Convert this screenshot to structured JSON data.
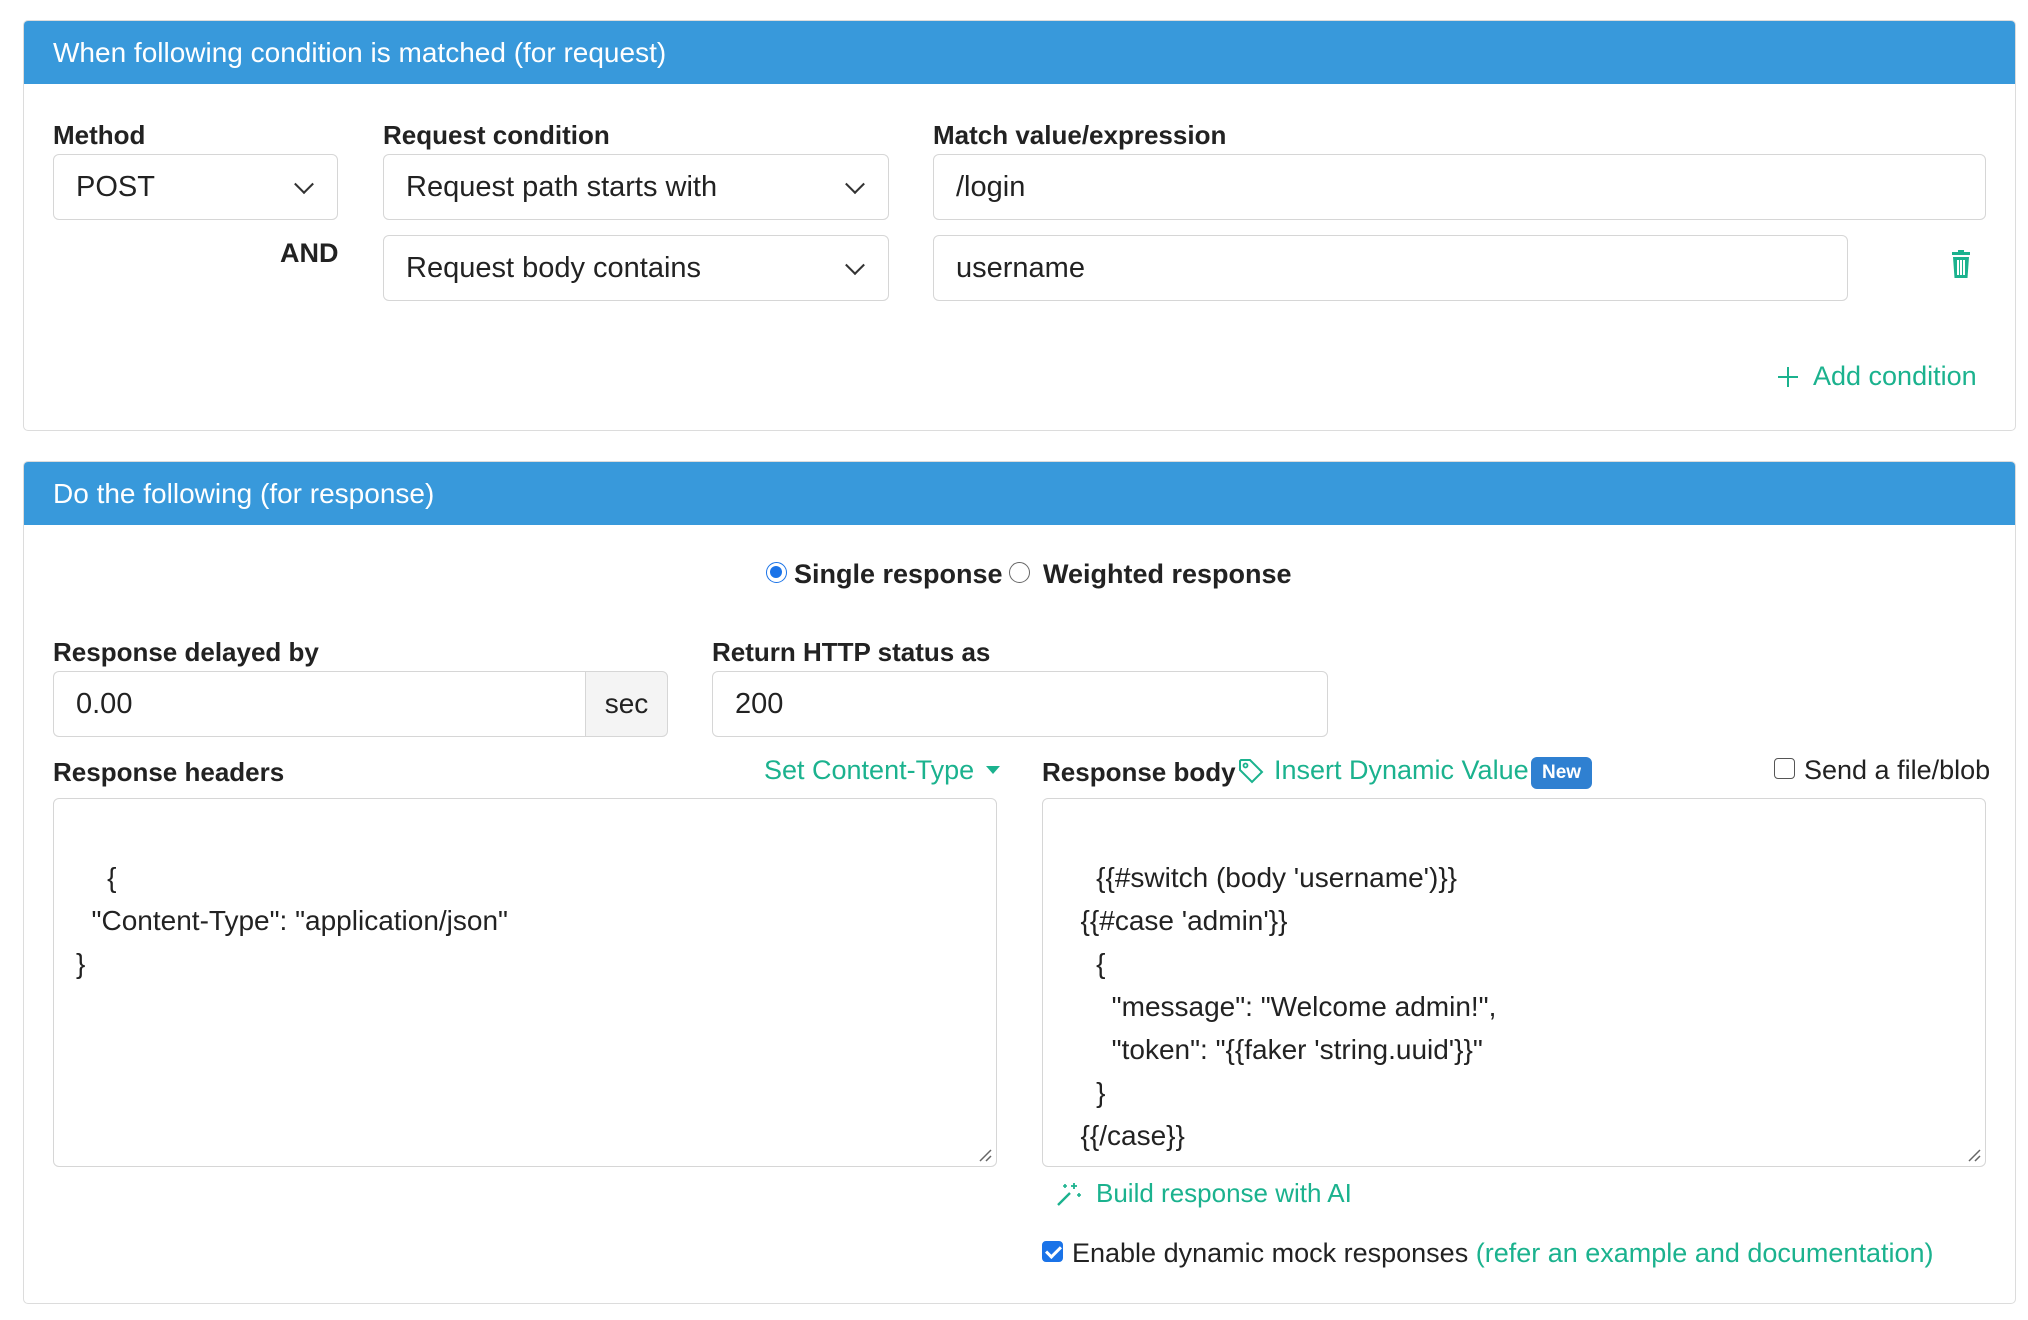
{
  "request_section": {
    "title": "When following condition is matched (for request)",
    "method_label": "Method",
    "method_value": "POST",
    "condition_label": "Request condition",
    "match_label": "Match value/expression",
    "and_label": "AND",
    "conditions": [
      {
        "type": "Request path starts with",
        "value": "/login"
      },
      {
        "type": "Request body contains",
        "value": "username"
      }
    ],
    "add_condition": "Add condition"
  },
  "response_section": {
    "title": "Do the following (for response)",
    "mode_single": "Single response",
    "mode_weighted": "Weighted response",
    "selected_mode": "single",
    "delay_label": "Response delayed by",
    "delay_value": "0.00",
    "delay_unit": "sec",
    "status_label": "Return HTTP status as",
    "status_value": "200",
    "headers_label": "Response headers",
    "set_content_type": "Set Content-Type",
    "headers_body": "{\n  \"Content-Type\": \"application/json\"\n}",
    "body_label": "Response body",
    "insert_dynamic": "Insert Dynamic Value",
    "new_badge": "New",
    "send_file_label": "Send a file/blob",
    "send_file_checked": false,
    "body_text": "{{#switch (body 'username')}}\n  {{#case 'admin'}}\n    {\n      \"message\": \"Welcome admin!\",\n      \"token\": \"{{faker 'string.uuid'}}\"\n    }\n  {{/case}}\n\n  {{#case 'guest'}}",
    "build_ai": "Build response with AI",
    "dynamic_mock_label": "Enable dynamic mock responses",
    "dynamic_mock_link": "(refer an example and documentation)",
    "dynamic_mock_checked": true
  },
  "colors": {
    "header_blue": "#3899db",
    "accent_green": "#1bb28e",
    "badge_blue": "#2f80d1",
    "check_blue": "#1a73e8"
  }
}
